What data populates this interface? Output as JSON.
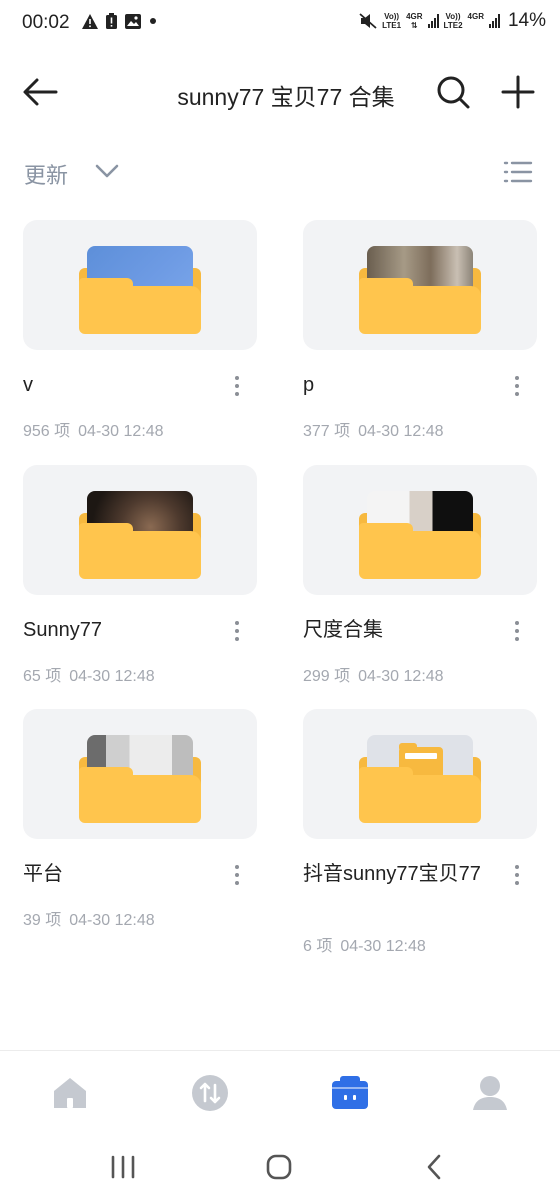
{
  "status_bar": {
    "time": "00:02",
    "sim1": {
      "top": "Vo))",
      "bottom": "LTE1",
      "type": "4GR"
    },
    "sim2": {
      "top": "Vo))",
      "bottom": "LTE2",
      "type": "4GR"
    },
    "battery": "14%"
  },
  "header": {
    "title": "sunny77  宝贝77 合集"
  },
  "sort": {
    "label": "更新"
  },
  "folders": [
    {
      "name": "v",
      "count": "956 项",
      "date": "04-30 12:48"
    },
    {
      "name": "p",
      "count": "377 项",
      "date": "04-30 12:48"
    },
    {
      "name": "Sunny77",
      "count": "65 项",
      "date": "04-30 12:48"
    },
    {
      "name": "尺度合集",
      "count": "299 项",
      "date": "04-30 12:48"
    },
    {
      "name": "平台",
      "count": "39 项",
      "date": "04-30 12:48"
    },
    {
      "name": "抖音sunny77宝贝77",
      "count": "6 项",
      "date": "04-30 12:48"
    }
  ],
  "colors": {
    "folder_yellow": "#ffc54d",
    "accent_blue": "#2f6fe6",
    "muted_gray": "#a4a8b0"
  },
  "icons": {
    "back": "arrow-left-icon",
    "search": "search-icon",
    "add": "plus-icon",
    "sort": "chevron-down-icon",
    "view": "list-view-icon",
    "more": "more-vertical-icon",
    "nav_home": "home-icon",
    "nav_transfer": "transfer-icon",
    "nav_files": "files-icon",
    "nav_profile": "profile-icon"
  }
}
